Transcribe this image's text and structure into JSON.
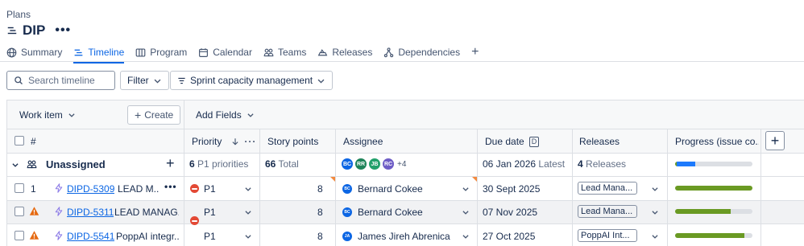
{
  "breadcrumb": "Plans",
  "plan": {
    "title": "DIP",
    "more_label": "•••"
  },
  "tabs": [
    {
      "label": "Summary",
      "icon": "globe-icon"
    },
    {
      "label": "Timeline",
      "icon": "timeline-icon",
      "active": true
    },
    {
      "label": "Program",
      "icon": "columns-icon"
    },
    {
      "label": "Calendar",
      "icon": "calendar-icon"
    },
    {
      "label": "Teams",
      "icon": "teams-icon"
    },
    {
      "label": "Releases",
      "icon": "ship-icon"
    },
    {
      "label": "Dependencies",
      "icon": "dependencies-icon"
    }
  ],
  "toolbar": {
    "search_placeholder": "Search timeline",
    "filter_label": "Filter",
    "sprint_label": "Sprint capacity management"
  },
  "grid": {
    "work_item_label": "Work item",
    "create_label": "Create",
    "add_fields_label": "Add Fields",
    "columns": {
      "number": "#",
      "priority": "Priority",
      "story_points": "Story points",
      "assignee": "Assignee",
      "due_date": "Due date",
      "due_date_badge": "D",
      "releases": "Releases",
      "progress": "Progress (issue co..."
    },
    "group": {
      "name": "Unassigned",
      "priority_count": "6",
      "priority_suffix": "P1 priorities",
      "points_total": "66",
      "points_suffix": "Total",
      "assignees": [
        "BC",
        "RR",
        "JB",
        "RC"
      ],
      "assignees_more": "+4",
      "due_date": "06 Jan 2026",
      "due_suffix": "Latest",
      "releases_count": "4",
      "releases_suffix": "Releases",
      "progress": {
        "done": 0.02,
        "in_progress": 0.24
      }
    },
    "rows": [
      {
        "number": "1",
        "key": "DIPD-5309",
        "summary": "LEAD M...",
        "more": "•••",
        "priority": "P1",
        "story_points": "8",
        "assignee_initials": "BC",
        "assignee": "Bernard Cokee",
        "due_date": "30 Sept 2025",
        "release": "Lead Mana...",
        "progress": {
          "done": 1.0,
          "in_progress": 0.0
        }
      },
      {
        "number": "",
        "key": "DIPD-5311",
        "summary": "LEAD MANAG...",
        "priority": "P1",
        "story_points": "8",
        "assignee_initials": "BC",
        "assignee": "Bernard Cokee",
        "due_date": "07 Nov 2025",
        "release": "Lead Mana...",
        "progress": {
          "done": 0.72,
          "in_progress": 0.0
        }
      },
      {
        "number": "",
        "key": "DIPD-5541",
        "summary": "PoppAI integr...",
        "priority": "P1",
        "story_points": "8",
        "assignee_initials": "JA",
        "assignee": "James Jireh Abrenica",
        "due_date": "27 Oct 2025",
        "release": "PoppAI Int...",
        "progress": {
          "done": 0.9,
          "in_progress": 0.0
        }
      }
    ]
  },
  "colors": {
    "accent": "#0c66e4",
    "priority_red": "#e34935",
    "warning_orange": "#e56910",
    "progress_done": "#6a9a23",
    "progress_in_progress": "#1d7afc",
    "epic_purple": "#8f7ee7"
  }
}
